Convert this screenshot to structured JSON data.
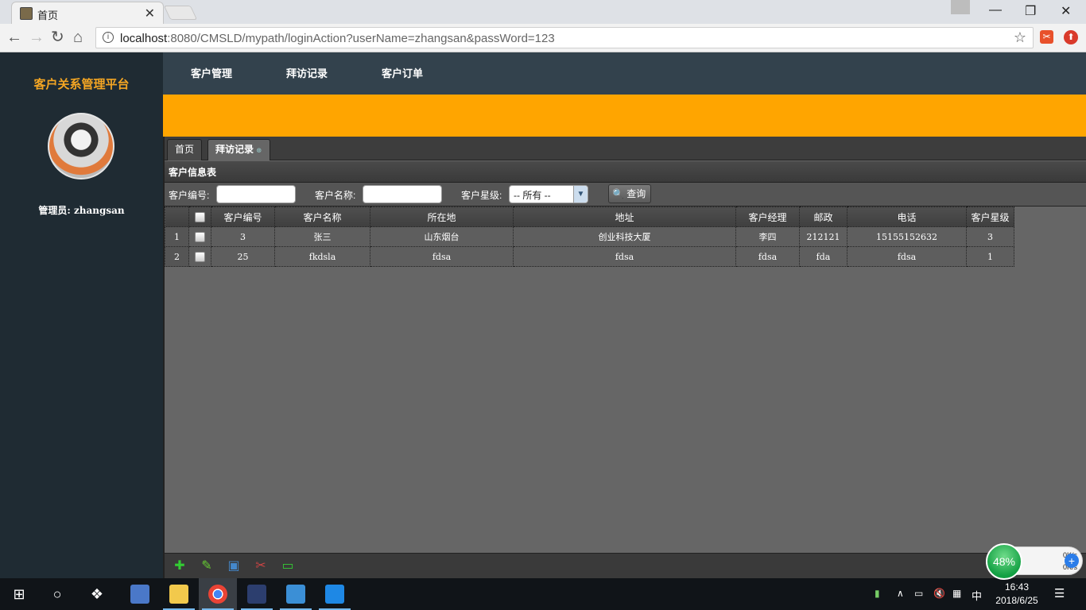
{
  "browser": {
    "tab_title": "首页",
    "url_host": "localhost",
    "url_rest": ":8080/CMSLD/mypath/loginAction?userName=zhangsan&passWord=123"
  },
  "sidebar": {
    "brand": "客户关系管理平台",
    "admin_label": "管理员: zhangsan"
  },
  "topnav": {
    "items": [
      {
        "label": "客户管理"
      },
      {
        "label": "拜访记录"
      },
      {
        "label": "客户订单"
      }
    ]
  },
  "page_tabs": [
    {
      "label": "首页"
    },
    {
      "label": "拜访记录"
    }
  ],
  "panel": {
    "title": "客户信息表"
  },
  "search": {
    "customer_id_label": "客户编号:",
    "customer_name_label": "客户名称:",
    "customer_level_label": "客户星级:",
    "level_selected": "-- 所有 --",
    "query_button": "查询"
  },
  "grid": {
    "columns": [
      "客户编号",
      "客户名称",
      "所在地",
      "地址",
      "客户经理",
      "邮政",
      "电话",
      "客户星级"
    ],
    "rows": [
      {
        "num": "1",
        "cells": [
          "3",
          "张三",
          "山东烟台",
          "创业科技大厦",
          "李四",
          "212121",
          "15155152632",
          "3"
        ]
      },
      {
        "num": "2",
        "cells": [
          "25",
          "fkdsla",
          "fdsa",
          "fdsa",
          "fdsa",
          "fda",
          "fdsa",
          "1"
        ]
      }
    ]
  },
  "speed_widget": {
    "percent": "48%",
    "upload": "0K/s",
    "download": "0K/s"
  },
  "taskbar": {
    "time": "16:43",
    "date": "2018/6/25",
    "ime": "中"
  },
  "colors": {
    "brand": "#f5a623",
    "banner": "#ffa500",
    "sidebar": "#1f2b33",
    "topnav": "#33424d"
  }
}
